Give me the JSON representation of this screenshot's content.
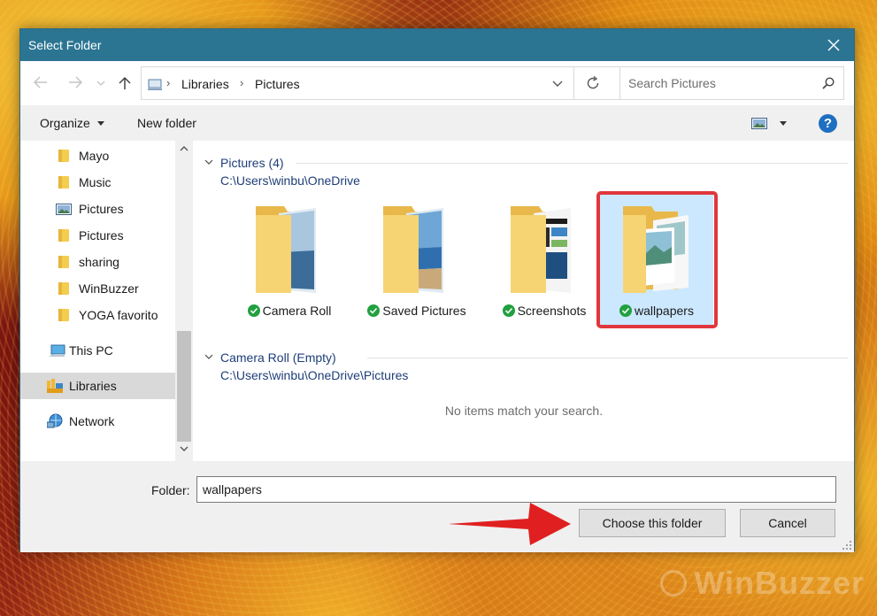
{
  "dialog": {
    "title": "Select Folder",
    "close_icon": "close-icon",
    "titlebar_color": "#2b7593"
  },
  "address": {
    "crumbs": [
      "Libraries",
      "Pictures"
    ],
    "location_icon": "libraries-pc-icon"
  },
  "search": {
    "placeholder": "Search Pictures",
    "icon": "search-icon"
  },
  "toolbar": {
    "organize_label": "Organize",
    "new_folder_label": "New folder",
    "help_label": "?"
  },
  "nav_pane": {
    "items": [
      {
        "label": "Mayo",
        "icon": "folder-icon"
      },
      {
        "label": "Music",
        "icon": "folder-icon"
      },
      {
        "label": "Pictures",
        "icon": "pictures-library-icon"
      },
      {
        "label": "Pictures",
        "icon": "folder-icon"
      },
      {
        "label": "sharing",
        "icon": "folder-icon"
      },
      {
        "label": "WinBuzzer",
        "icon": "folder-icon"
      },
      {
        "label": "YOGA favorito",
        "icon": "folder-icon"
      },
      {
        "label": "This PC",
        "icon": "computer-icon"
      },
      {
        "label": "Libraries",
        "icon": "libraries-icon",
        "selected": true
      },
      {
        "label": "Network",
        "icon": "network-icon"
      }
    ]
  },
  "content": {
    "groups": [
      {
        "title": "Pictures (4)",
        "path": "C:\\Users\\winbu\\OneDrive",
        "items": [
          {
            "label": "Camera Roll",
            "icon": "sync-check-icon"
          },
          {
            "label": "Saved Pictures",
            "icon": "sync-check-icon"
          },
          {
            "label": "Screenshots",
            "icon": "sync-check-icon"
          },
          {
            "label": "wallpapers",
            "icon": "sync-check-icon",
            "selected": true
          }
        ]
      },
      {
        "title": "Camera Roll (Empty)",
        "path": "C:\\Users\\winbu\\OneDrive\\Pictures",
        "items": []
      }
    ],
    "empty_message": "No items match your search."
  },
  "footer": {
    "folder_label": "Folder:",
    "folder_value": "wallpapers",
    "choose_label": "Choose this folder",
    "cancel_label": "Cancel"
  },
  "annotation": {
    "highlight_color": "#e0373c",
    "arrow_color": "#e02020"
  },
  "watermark": "WinBuzzer"
}
